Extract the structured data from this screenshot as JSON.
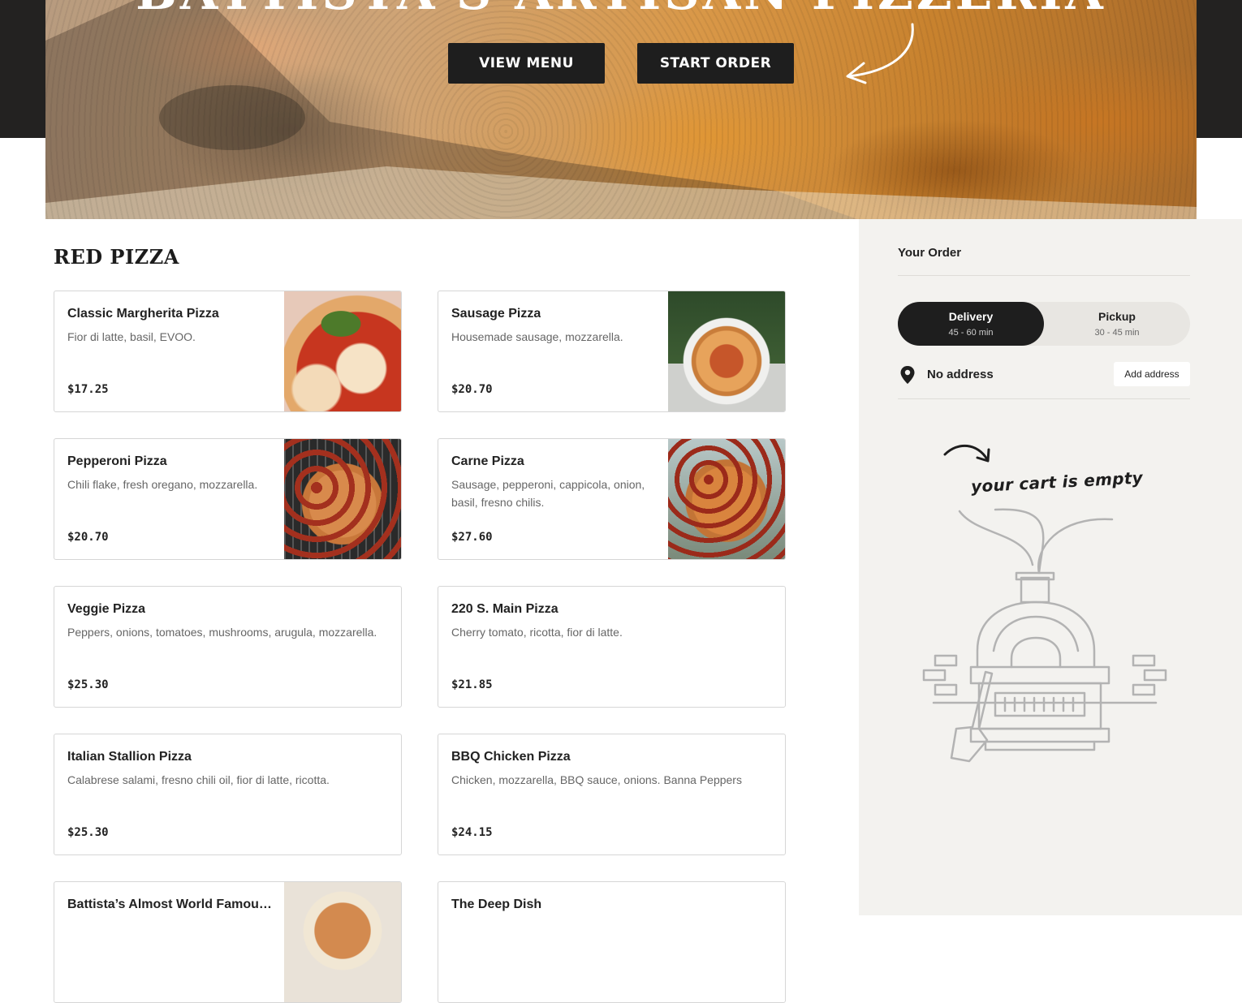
{
  "hero": {
    "title": "BATTISTA'S ARTISAN PIZZERIA",
    "view_menu_label": "VIEW MENU",
    "start_order_label": "START ORDER"
  },
  "menu": {
    "section_title": "RED PIZZA",
    "items": [
      {
        "name": "Classic Margherita Pizza",
        "description": "Fior di latte, basil, EVOO.",
        "price": "$17.25",
        "image": "margherita"
      },
      {
        "name": "Sausage Pizza",
        "description": "Housemade sausage, mozzarella.",
        "price": "$20.70",
        "image": "sausage"
      },
      {
        "name": "Pepperoni Pizza",
        "description": "Chili flake, fresh oregano, mozzarella.",
        "price": "$20.70",
        "image": "pepperoni"
      },
      {
        "name": "Carne Pizza",
        "description": "Sausage, pepperoni, cappicola, onion, basil, fresno chilis.",
        "price": "$27.60",
        "image": "carne"
      },
      {
        "name": "Veggie Pizza",
        "description": "Peppers, onions, tomatoes, mushrooms, arugula, mozzarella.",
        "price": "$25.30",
        "image": null
      },
      {
        "name": "220 S. Main Pizza",
        "description": "Cherry tomato, ricotta, fior di latte.",
        "price": "$21.85",
        "image": null
      },
      {
        "name": "Italian Stallion Pizza",
        "description": "Calabrese salami, fresno chili oil, fior di latte, ricotta.",
        "price": "$25.30",
        "image": null
      },
      {
        "name": "BBQ Chicken Pizza",
        "description": "Chicken, mozzarella, BBQ sauce, onions. Banna Peppers",
        "price": "$24.15",
        "image": null
      },
      {
        "name": "Battista’s Almost World Famous…",
        "description": "",
        "price": "",
        "image": "famous"
      },
      {
        "name": "The Deep Dish",
        "description": "",
        "price": "",
        "image": null
      }
    ]
  },
  "order": {
    "title": "Your Order",
    "delivery": {
      "label": "Delivery",
      "time": "45 - 60 min",
      "selected": true
    },
    "pickup": {
      "label": "Pickup",
      "time": "30 - 45 min",
      "selected": false
    },
    "address_text": "No address",
    "add_address_label": "Add address",
    "empty_cart_text": "your cart is empty"
  },
  "icons": [
    "hand-drawn-arrow-icon",
    "location-pin-icon",
    "pizza-oven-illustration"
  ],
  "colors": {
    "dark": "#1e1e1e",
    "sidebar_bg": "#f3f2ef",
    "border": "#d6d6d6"
  }
}
